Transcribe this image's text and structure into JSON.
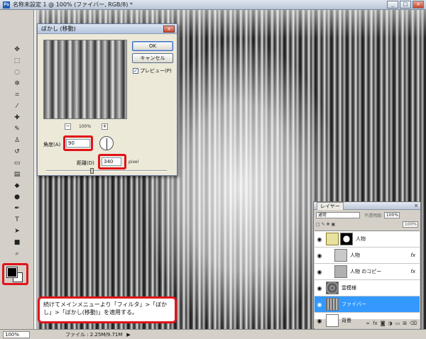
{
  "window": {
    "app_icon": "Ps",
    "title": "名称未設定 1 @ 100% (ファイバー, RGB/8) *",
    "controls": [
      "_",
      "□",
      "×"
    ]
  },
  "dialog": {
    "title": "ぼかし (移動)",
    "close": "×",
    "ok_label": "OK",
    "cancel_label": "キャンセル",
    "preview_label": "プレビュー(P)",
    "preview_checked": true,
    "zoom_label": "100%",
    "zoom_minus": "−",
    "zoom_plus": "+",
    "angle_label": "角度(A)",
    "angle_value": "90",
    "distance_label": "距離(D)",
    "distance_value": "340",
    "distance_unit": "pixel"
  },
  "statusbar": {
    "zoom": "100%",
    "file_info": "ファイル : 2.25M/9.71M",
    "arrow": "▶"
  },
  "layers_panel": {
    "tab_label": "レイヤー",
    "close": "×",
    "blend_mode": "通常",
    "opacity_label": "不透明度:",
    "opacity_value": "100%",
    "fill_value": "100%",
    "layers": [
      {
        "name": "人物",
        "type": "group",
        "fx": ""
      },
      {
        "name": "人物",
        "type": "layer",
        "fx": "fx"
      },
      {
        "name": "人物 のコピー",
        "type": "layer",
        "fx": "fx"
      },
      {
        "name": "雲模様",
        "type": "layer",
        "fx": ""
      },
      {
        "name": "ファイバー",
        "type": "layer",
        "fx": "",
        "selected": true
      },
      {
        "name": "背景",
        "type": "layer",
        "fx": ""
      }
    ],
    "footer_icons": [
      "link-icon",
      "fx-icon",
      "mask-icon",
      "adjustment-icon",
      "folder-icon",
      "new-layer-icon",
      "trash-icon"
    ]
  },
  "callout": {
    "text": "続けてメインメニューより「フィルタ」>「ぼかし」>「ぼかし(移動)」を適用する。"
  },
  "colors": {
    "highlight": "#e0141b",
    "selected_layer": "#3399ff"
  }
}
